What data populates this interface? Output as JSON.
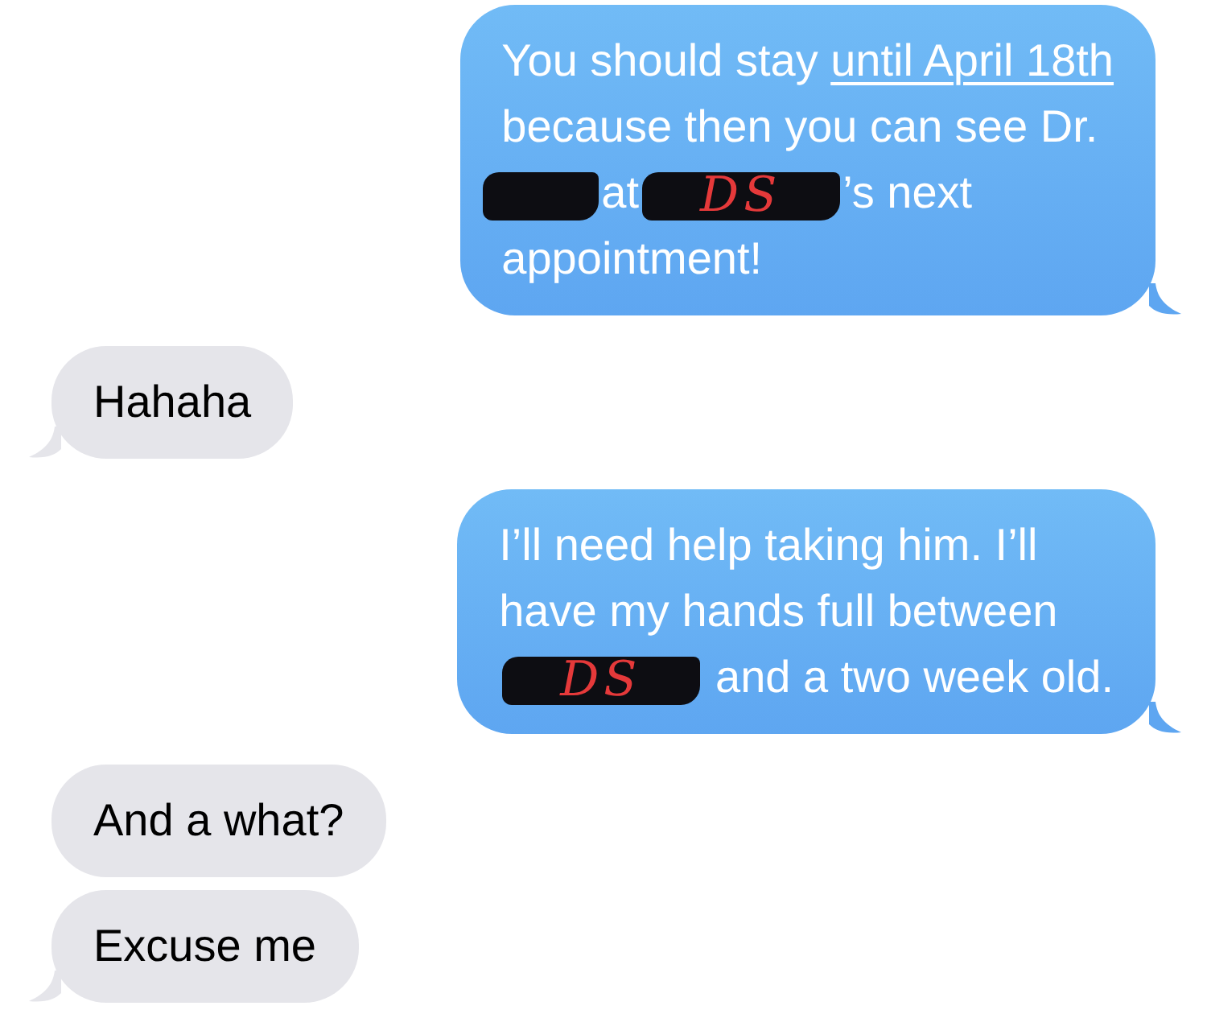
{
  "messages": [
    {
      "kind": "sent",
      "lines": [
        [
          {
            "kind": "text",
            "text": "You should stay "
          },
          {
            "kind": "link",
            "text": "until April 18th"
          }
        ],
        [
          {
            "kind": "text",
            "text": "because then you can see Dr."
          }
        ],
        [
          {
            "kind": "redaction"
          },
          {
            "kind": "text",
            "text": "at"
          },
          {
            "kind": "redaction",
            "text": "DS"
          },
          {
            "kind": "text",
            "text": "’s next"
          }
        ],
        [
          {
            "kind": "text",
            "text": "appointment!"
          }
        ]
      ]
    },
    {
      "kind": "received",
      "lines": [
        [
          {
            "kind": "text",
            "text": "Hahaha"
          }
        ]
      ]
    },
    {
      "kind": "sent",
      "lines": [
        [
          {
            "kind": "text",
            "text": "I’ll need help taking him. I’ll"
          }
        ],
        [
          {
            "kind": "text",
            "text": "have my hands full between"
          }
        ],
        [
          {
            "kind": "redaction",
            "text": "DS"
          },
          {
            "kind": "text",
            "text": " and a two week old."
          }
        ]
      ]
    },
    {
      "kind": "received",
      "lines": [
        [
          {
            "kind": "text",
            "text": "And a what?"
          }
        ]
      ]
    },
    {
      "kind": "received",
      "lines": [
        [
          {
            "kind": "text",
            "text": "Excuse me"
          }
        ]
      ]
    }
  ]
}
